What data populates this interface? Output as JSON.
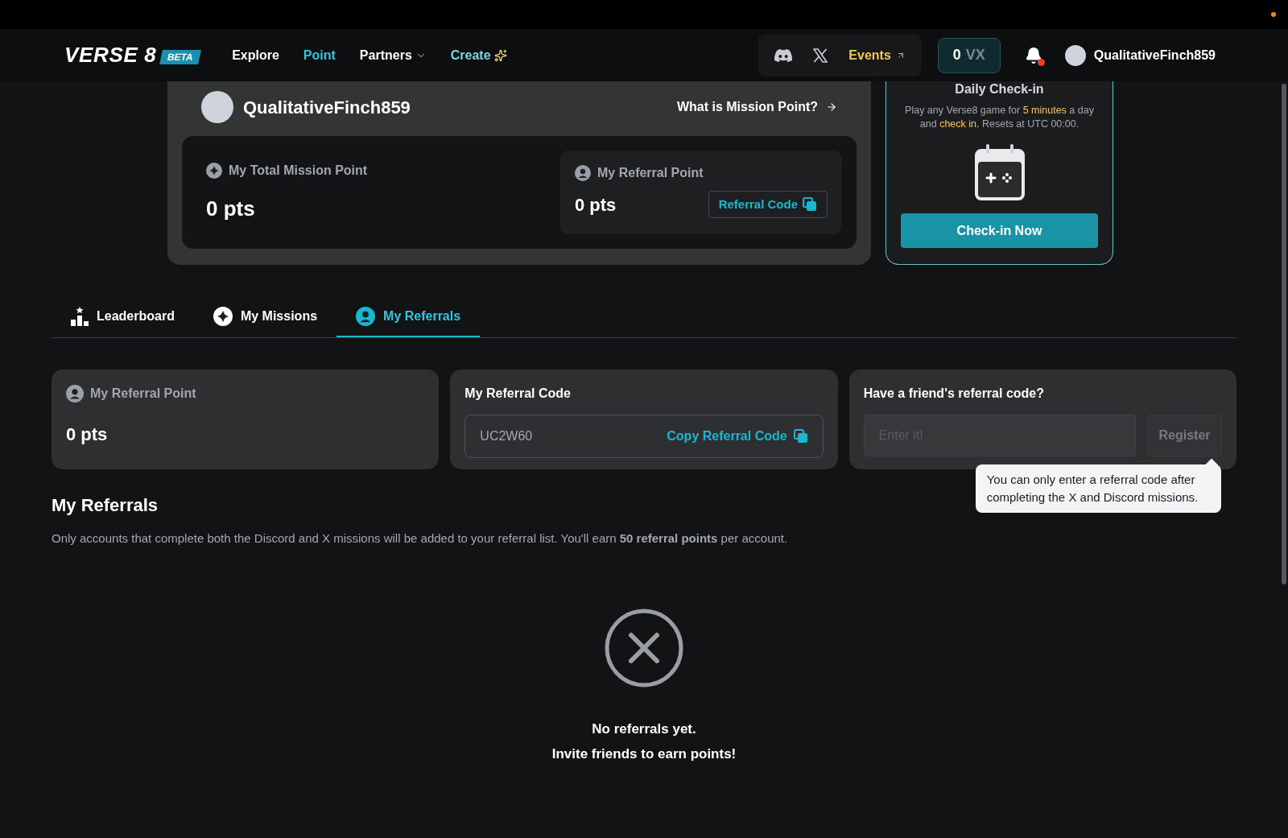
{
  "nav": {
    "logo": "VERSE 8",
    "badge": "BETA",
    "links": [
      {
        "label": "Explore",
        "selected": false,
        "kind": "plain"
      },
      {
        "label": "Point",
        "selected": true,
        "kind": "plain"
      },
      {
        "label": "Partners",
        "selected": false,
        "kind": "dropdown"
      },
      {
        "label": "Create",
        "selected": false,
        "kind": "create"
      }
    ],
    "events": "Events",
    "balance": {
      "amount": "0",
      "unit": "VX"
    },
    "notifications_unread": true,
    "username": "QualitativeFinch859"
  },
  "profile": {
    "username": "QualitativeFinch859",
    "help_link": "What is Mission Point?",
    "total": {
      "label": "My Total Mission Point",
      "value": "0 pts"
    },
    "referral": {
      "label": "My Referral Point",
      "value": "0 pts",
      "button": "Referral Code"
    }
  },
  "checkin": {
    "title": "Daily Check-in",
    "description": [
      {
        "text": "Play any Verse8 game for ",
        "highlight": false
      },
      {
        "text": "5 minutes",
        "highlight": true
      },
      {
        "text": " a day and ",
        "highlight": false
      },
      {
        "text": "check in.",
        "highlight": true
      },
      {
        "text": " Resets at UTC 00:00.",
        "highlight": false
      }
    ],
    "button": "Check-in Now"
  },
  "tabs": [
    {
      "label": "Leaderboard",
      "kind": "leaderboard",
      "selected": false
    },
    {
      "label": "My Missions",
      "kind": "missions",
      "selected": false
    },
    {
      "label": "My Referrals",
      "kind": "referrals",
      "selected": true
    }
  ],
  "referral_point": {
    "label": "My Referral Point",
    "value": "0 pts"
  },
  "referral_code": {
    "label": "My Referral Code",
    "code": "UC2W60",
    "button": "Copy Referral Code"
  },
  "friend_code": {
    "label": "Have a friend's referral code?",
    "placeholder": "Enter it!",
    "button": "Register",
    "disabled": true,
    "tooltip": "You can only enter a referral code after completing the X and Discord missions."
  },
  "referrals": {
    "title": "My Referrals",
    "description": "Only accounts that complete both the Discord and X missions will be added to your referral list. You'll earn **50 referral points** per account.",
    "empty_title": "No referrals yet.",
    "empty_subtitle": "Invite friends to earn points!"
  }
}
